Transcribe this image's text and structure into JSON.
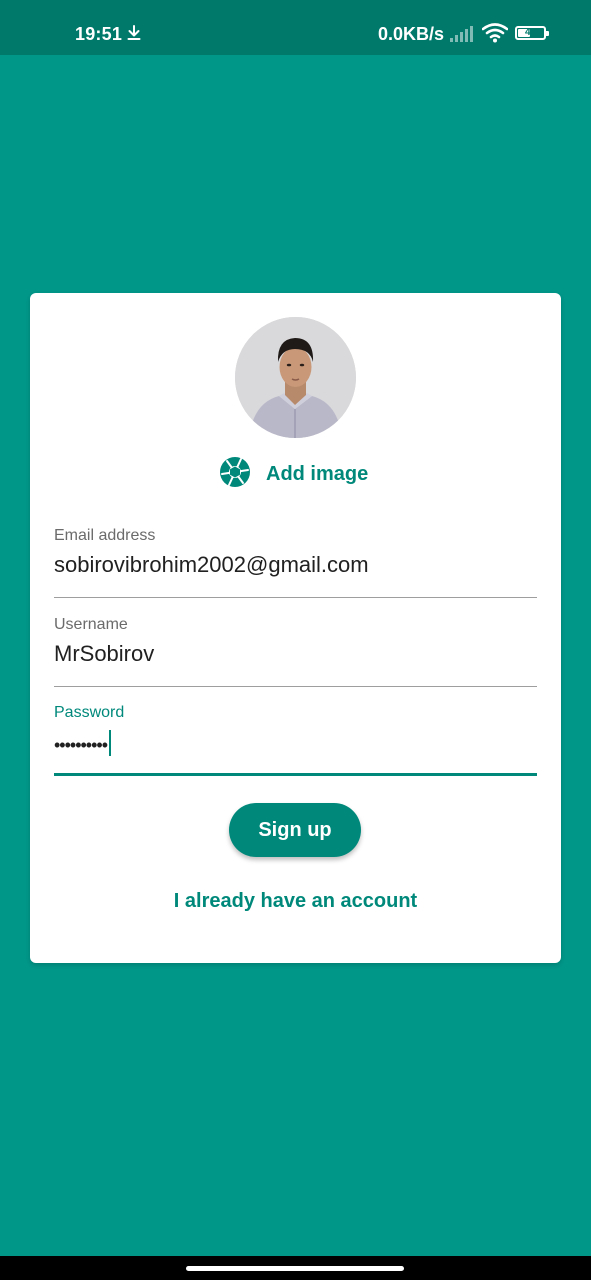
{
  "status_bar": {
    "time": "19:51",
    "download_icon": "download-arrow-icon",
    "network_speed": "0.0KB/s",
    "signal_icon": "cell-signal-icon",
    "wifi_icon": "wifi-icon",
    "battery_level": "49",
    "battery_fraction": 0.49
  },
  "card": {
    "avatar_description": "profile-photo",
    "add_image": {
      "icon": "camera-aperture-icon",
      "label": "Add image"
    },
    "fields": {
      "email": {
        "label": "Email address",
        "value": "sobirovibrohim2002@gmail.com"
      },
      "username": {
        "label": "Username",
        "value": "MrSobirov"
      },
      "password": {
        "label": "Password",
        "value": "••••••••••"
      }
    },
    "signup_label": "Sign up",
    "login_link": "I already have an account"
  },
  "colors": {
    "background": "#009688",
    "status_bar": "#00796b",
    "accent": "#00897b",
    "card": "#ffffff"
  }
}
